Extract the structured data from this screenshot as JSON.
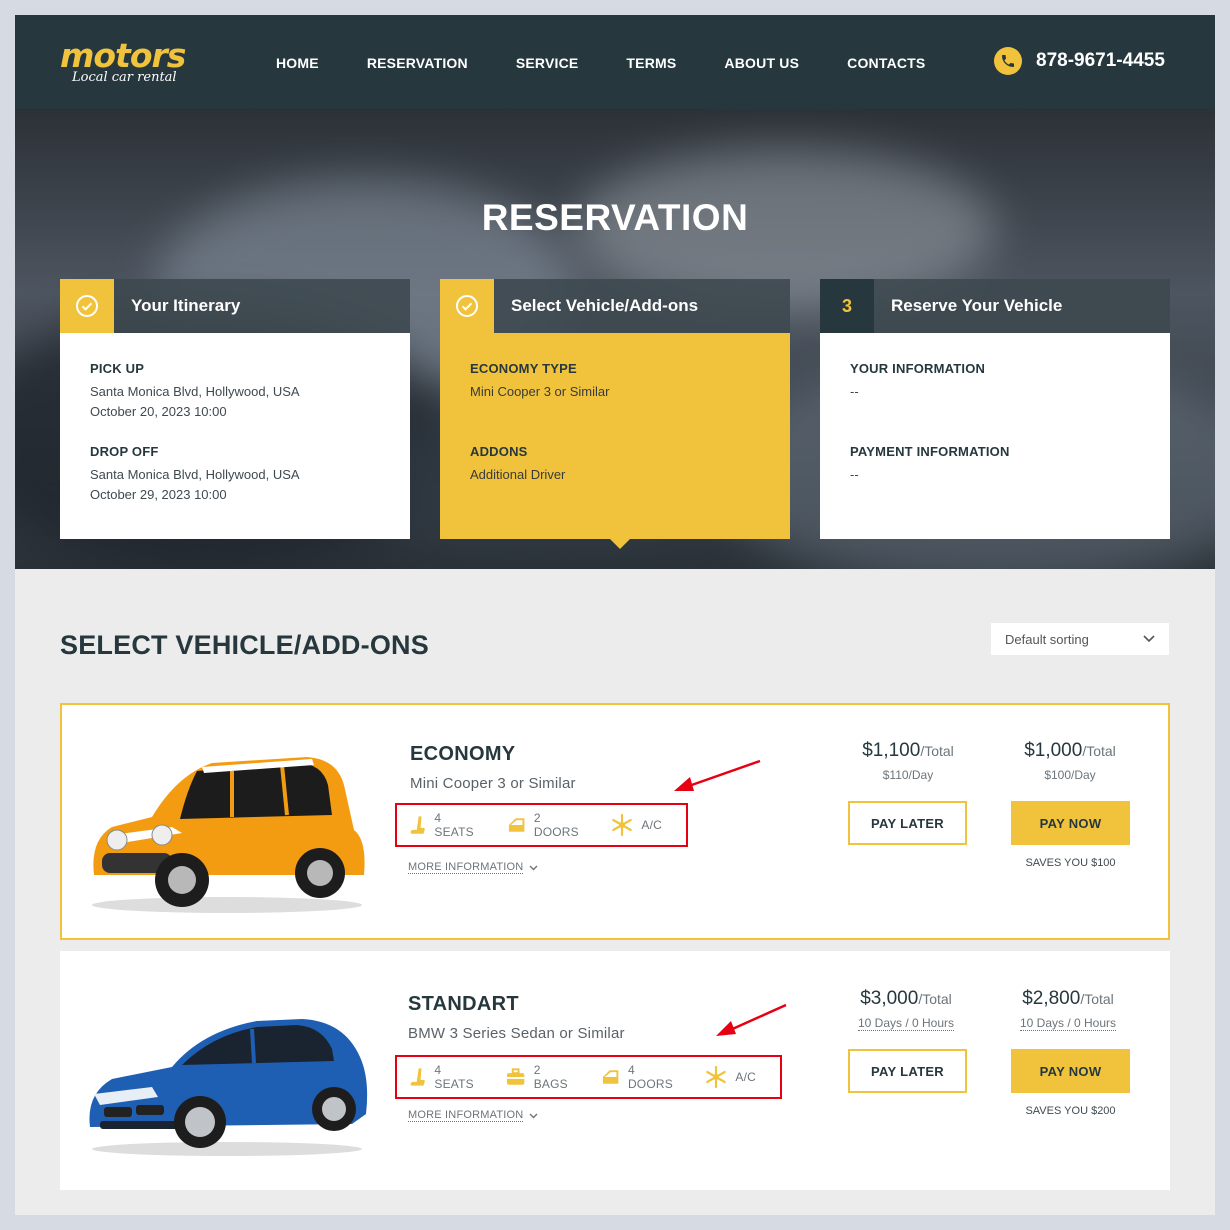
{
  "brand": {
    "logo": "motors",
    "tagline": "Local car rental"
  },
  "nav": [
    "HOME",
    "RESERVATION",
    "SERVICE",
    "TERMS",
    "ABOUT US",
    "CONTACTS"
  ],
  "phone": "878-9671-4455",
  "hero": {
    "title": "RESERVATION"
  },
  "steps": [
    {
      "badge": "",
      "title": "Your Itinerary",
      "groups": [
        {
          "label": "PICK UP",
          "lines": [
            "Santa Monica Blvd, Hollywood, USA",
            "October 20, 2023 10:00"
          ]
        },
        {
          "label": "DROP OFF",
          "lines": [
            "Santa Monica Blvd, Hollywood, USA",
            "October 29, 2023 10:00"
          ]
        }
      ]
    },
    {
      "badge": "",
      "title": "Select Vehicle/Add-ons",
      "groups": [
        {
          "label": "ECONOMY TYPE",
          "lines": [
            "Mini Cooper 3 or Similar"
          ]
        },
        {
          "label": "ADDONS",
          "lines": [
            "Additional Driver"
          ]
        }
      ]
    },
    {
      "badge": "3",
      "title": "Reserve Your Vehicle",
      "groups": [
        {
          "label": "YOUR INFORMATION",
          "lines": [
            "--"
          ]
        },
        {
          "label": "PAYMENT INFORMATION",
          "lines": [
            "--"
          ]
        }
      ]
    }
  ],
  "listing": {
    "title": "SELECT VEHICLE/ADD-ONS",
    "sort_value": "Default sorting"
  },
  "vehicles": [
    {
      "name": "ECONOMY",
      "model": "Mini Cooper 3 or Similar",
      "features": [
        "4 SEATS",
        "2 DOORS",
        "A/C"
      ],
      "more_info": "MORE INFORMATION",
      "pay_later": {
        "amount": "$1,100",
        "unit": "/Total",
        "detail": "$110/Day"
      },
      "pay_now": {
        "amount": "$1,000",
        "unit": "/Total",
        "detail": "$100/Day"
      },
      "pay_later_label": "PAY LATER",
      "pay_now_label": "PAY NOW",
      "saves": "SAVES YOU $100",
      "color": "#f39c12"
    },
    {
      "name": "STANDART",
      "model": "BMW 3 Series Sedan or Similar",
      "features": [
        "4 SEATS",
        "2 BAGS",
        "4 DOORS",
        "A/C"
      ],
      "more_info": "MORE INFORMATION",
      "pay_later": {
        "amount": "$3,000",
        "unit": "/Total",
        "detail": "10 Days / 0 Hours"
      },
      "pay_now": {
        "amount": "$2,800",
        "unit": "/Total",
        "detail": "10 Days / 0 Hours"
      },
      "pay_later_label": "PAY LATER",
      "pay_now_label": "PAY NOW",
      "saves": "SAVES YOU $200",
      "color": "#1f5fb3"
    }
  ],
  "colors": {
    "accent": "#f1c33c",
    "dark": "#26383e",
    "highlight": "#e60012"
  }
}
